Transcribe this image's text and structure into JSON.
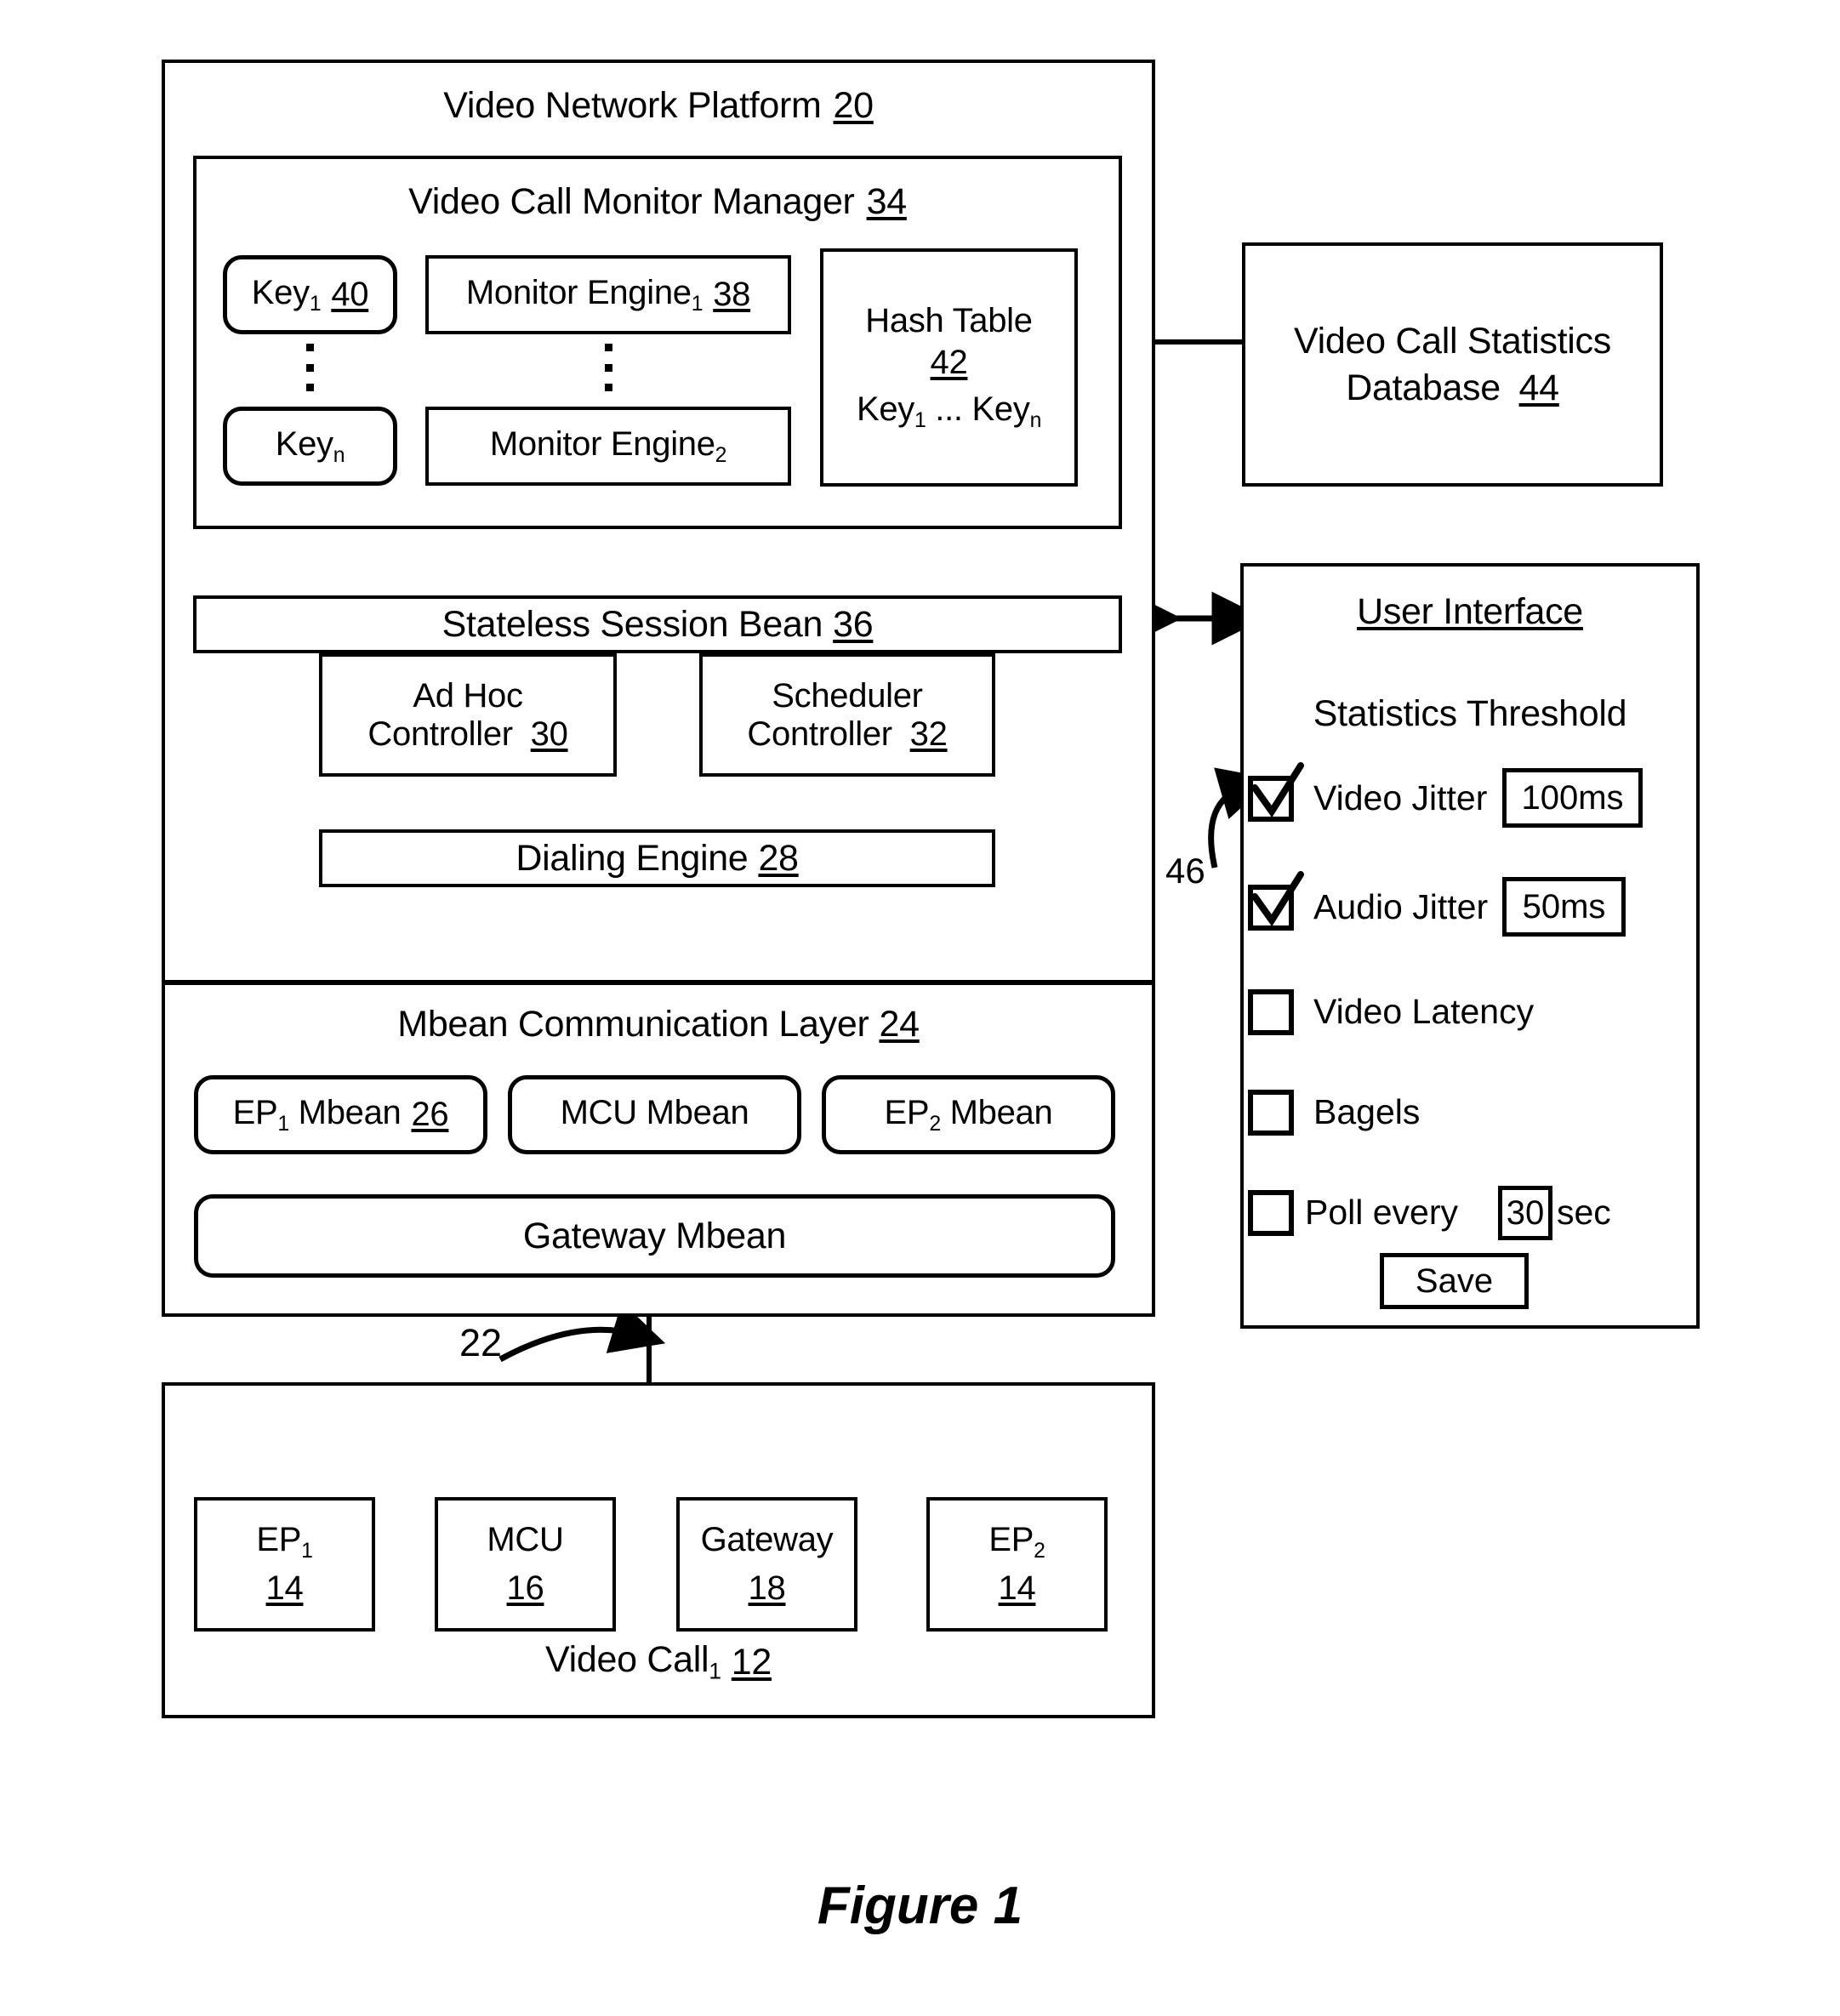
{
  "figure": {
    "caption": "Figure 1"
  },
  "platform": {
    "title": "Video Network Platform",
    "ref": "20",
    "manager": {
      "title": "Video Call Monitor Manager",
      "ref": "34",
      "keys": [
        {
          "label": "Key",
          "sub": "1",
          "ref": "40"
        },
        {
          "label": "Key",
          "sub": "n",
          "ref": ""
        }
      ],
      "engines": [
        {
          "label": "Monitor Engine",
          "sub": "1",
          "ref": "38"
        },
        {
          "label": "Monitor Engine",
          "sub": "2",
          "ref": ""
        }
      ],
      "hash_table": {
        "title": "Hash Table",
        "ref": "42",
        "contents_prefix": "Key",
        "contents_sub1": "1",
        "contents_mid": " ... Key",
        "contents_sub2": "n"
      }
    },
    "session_bean": {
      "label": "Stateless Session Bean",
      "ref": "36"
    },
    "controllers": [
      {
        "line1": "Ad Hoc",
        "line2": "Controller",
        "ref": "30"
      },
      {
        "line1": "Scheduler",
        "line2": "Controller",
        "ref": "32"
      }
    ],
    "dialing_engine": {
      "label": "Dialing Engine",
      "ref": "28"
    },
    "mbean_layer": {
      "title": "Mbean Communication Layer",
      "ref": "24",
      "mbeans": [
        {
          "label": "EP",
          "sub": "1",
          "suffix": " Mbean",
          "ref": "26"
        },
        {
          "label": "MCU Mbean",
          "sub": "",
          "suffix": "",
          "ref": ""
        },
        {
          "label": "EP",
          "sub": "2",
          "suffix": " Mbean",
          "ref": ""
        }
      ],
      "gateway": {
        "label": "Gateway Mbean"
      }
    }
  },
  "statistics_database": {
    "line1": "Video Call Statistics",
    "line2": "Database",
    "ref": "44"
  },
  "user_interface": {
    "title": "User Interface",
    "section_title": "Statistics Threshold",
    "callout_ref": "46",
    "options": [
      {
        "label": "Video Jitter",
        "checked": true,
        "value": "100ms",
        "has_value": true
      },
      {
        "label": "Audio Jitter",
        "checked": true,
        "value": "50ms",
        "has_value": true
      },
      {
        "label": "Video Latency",
        "checked": false,
        "value": "",
        "has_value": false
      },
      {
        "label": "Bagels",
        "checked": false,
        "value": "",
        "has_value": false
      }
    ],
    "poll": {
      "prefix": "Poll every",
      "value": "30",
      "suffix": "sec",
      "checked": false
    },
    "save_label": "Save"
  },
  "video_call": {
    "title": "Video Call",
    "title_sub": "1",
    "ref": "12",
    "connector_ref": "22",
    "nodes": [
      {
        "label": "EP",
        "sub": "1",
        "ref": "14"
      },
      {
        "label": "MCU",
        "sub": "",
        "ref": "16"
      },
      {
        "label": "Gateway",
        "sub": "",
        "ref": "18"
      },
      {
        "label": "EP",
        "sub": "2",
        "ref": "14"
      }
    ]
  }
}
